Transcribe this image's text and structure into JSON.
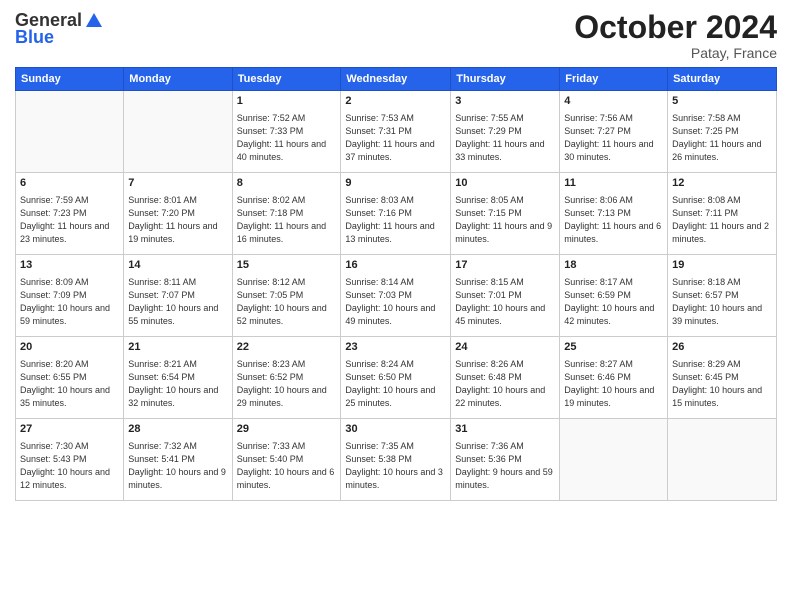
{
  "logo": {
    "general": "General",
    "blue": "Blue"
  },
  "header": {
    "month": "October 2024",
    "location": "Patay, France"
  },
  "days_of_week": [
    "Sunday",
    "Monday",
    "Tuesday",
    "Wednesday",
    "Thursday",
    "Friday",
    "Saturday"
  ],
  "weeks": [
    [
      {
        "day": "",
        "info": ""
      },
      {
        "day": "",
        "info": ""
      },
      {
        "day": "1",
        "info": "Sunrise: 7:52 AM\nSunset: 7:33 PM\nDaylight: 11 hours and 40 minutes."
      },
      {
        "day": "2",
        "info": "Sunrise: 7:53 AM\nSunset: 7:31 PM\nDaylight: 11 hours and 37 minutes."
      },
      {
        "day": "3",
        "info": "Sunrise: 7:55 AM\nSunset: 7:29 PM\nDaylight: 11 hours and 33 minutes."
      },
      {
        "day": "4",
        "info": "Sunrise: 7:56 AM\nSunset: 7:27 PM\nDaylight: 11 hours and 30 minutes."
      },
      {
        "day": "5",
        "info": "Sunrise: 7:58 AM\nSunset: 7:25 PM\nDaylight: 11 hours and 26 minutes."
      }
    ],
    [
      {
        "day": "6",
        "info": "Sunrise: 7:59 AM\nSunset: 7:23 PM\nDaylight: 11 hours and 23 minutes."
      },
      {
        "day": "7",
        "info": "Sunrise: 8:01 AM\nSunset: 7:20 PM\nDaylight: 11 hours and 19 minutes."
      },
      {
        "day": "8",
        "info": "Sunrise: 8:02 AM\nSunset: 7:18 PM\nDaylight: 11 hours and 16 minutes."
      },
      {
        "day": "9",
        "info": "Sunrise: 8:03 AM\nSunset: 7:16 PM\nDaylight: 11 hours and 13 minutes."
      },
      {
        "day": "10",
        "info": "Sunrise: 8:05 AM\nSunset: 7:15 PM\nDaylight: 11 hours and 9 minutes."
      },
      {
        "day": "11",
        "info": "Sunrise: 8:06 AM\nSunset: 7:13 PM\nDaylight: 11 hours and 6 minutes."
      },
      {
        "day": "12",
        "info": "Sunrise: 8:08 AM\nSunset: 7:11 PM\nDaylight: 11 hours and 2 minutes."
      }
    ],
    [
      {
        "day": "13",
        "info": "Sunrise: 8:09 AM\nSunset: 7:09 PM\nDaylight: 10 hours and 59 minutes."
      },
      {
        "day": "14",
        "info": "Sunrise: 8:11 AM\nSunset: 7:07 PM\nDaylight: 10 hours and 55 minutes."
      },
      {
        "day": "15",
        "info": "Sunrise: 8:12 AM\nSunset: 7:05 PM\nDaylight: 10 hours and 52 minutes."
      },
      {
        "day": "16",
        "info": "Sunrise: 8:14 AM\nSunset: 7:03 PM\nDaylight: 10 hours and 49 minutes."
      },
      {
        "day": "17",
        "info": "Sunrise: 8:15 AM\nSunset: 7:01 PM\nDaylight: 10 hours and 45 minutes."
      },
      {
        "day": "18",
        "info": "Sunrise: 8:17 AM\nSunset: 6:59 PM\nDaylight: 10 hours and 42 minutes."
      },
      {
        "day": "19",
        "info": "Sunrise: 8:18 AM\nSunset: 6:57 PM\nDaylight: 10 hours and 39 minutes."
      }
    ],
    [
      {
        "day": "20",
        "info": "Sunrise: 8:20 AM\nSunset: 6:55 PM\nDaylight: 10 hours and 35 minutes."
      },
      {
        "day": "21",
        "info": "Sunrise: 8:21 AM\nSunset: 6:54 PM\nDaylight: 10 hours and 32 minutes."
      },
      {
        "day": "22",
        "info": "Sunrise: 8:23 AM\nSunset: 6:52 PM\nDaylight: 10 hours and 29 minutes."
      },
      {
        "day": "23",
        "info": "Sunrise: 8:24 AM\nSunset: 6:50 PM\nDaylight: 10 hours and 25 minutes."
      },
      {
        "day": "24",
        "info": "Sunrise: 8:26 AM\nSunset: 6:48 PM\nDaylight: 10 hours and 22 minutes."
      },
      {
        "day": "25",
        "info": "Sunrise: 8:27 AM\nSunset: 6:46 PM\nDaylight: 10 hours and 19 minutes."
      },
      {
        "day": "26",
        "info": "Sunrise: 8:29 AM\nSunset: 6:45 PM\nDaylight: 10 hours and 15 minutes."
      }
    ],
    [
      {
        "day": "27",
        "info": "Sunrise: 7:30 AM\nSunset: 5:43 PM\nDaylight: 10 hours and 12 minutes."
      },
      {
        "day": "28",
        "info": "Sunrise: 7:32 AM\nSunset: 5:41 PM\nDaylight: 10 hours and 9 minutes."
      },
      {
        "day": "29",
        "info": "Sunrise: 7:33 AM\nSunset: 5:40 PM\nDaylight: 10 hours and 6 minutes."
      },
      {
        "day": "30",
        "info": "Sunrise: 7:35 AM\nSunset: 5:38 PM\nDaylight: 10 hours and 3 minutes."
      },
      {
        "day": "31",
        "info": "Sunrise: 7:36 AM\nSunset: 5:36 PM\nDaylight: 9 hours and 59 minutes."
      },
      {
        "day": "",
        "info": ""
      },
      {
        "day": "",
        "info": ""
      }
    ]
  ]
}
